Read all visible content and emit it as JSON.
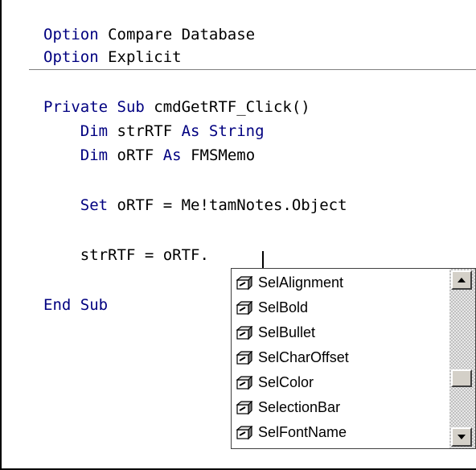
{
  "code": {
    "line1": {
      "kw": "Option",
      "rest": " Compare Database"
    },
    "line2": {
      "kw": "Option",
      "rest": " Explicit"
    },
    "line3": {
      "kw": "Private Sub",
      "rest": " cmdGetRTF_Click()"
    },
    "line4": {
      "indent": "    ",
      "kw1": "Dim",
      "mid": " strRTF ",
      "kw2": "As String"
    },
    "line5": {
      "indent": "    ",
      "kw1": "Dim",
      "mid": " oRTF ",
      "kw2": "As",
      "rest": " FMSMemo"
    },
    "line6": {
      "indent": "    ",
      "kw": "Set",
      "rest": " oRTF = Me!tamNotes.Object"
    },
    "line7": {
      "text": "    strRTF = oRTF."
    },
    "line8": {
      "kw": "End Sub"
    }
  },
  "autocomplete": {
    "items": [
      {
        "label": "SelAlignment",
        "icon": "property-icon"
      },
      {
        "label": "SelBold",
        "icon": "property-icon"
      },
      {
        "label": "SelBullet",
        "icon": "property-icon"
      },
      {
        "label": "SelCharOffset",
        "icon": "property-icon"
      },
      {
        "label": "SelColor",
        "icon": "property-icon"
      },
      {
        "label": "SelectionBar",
        "icon": "property-icon"
      },
      {
        "label": "SelFontName",
        "icon": "property-icon"
      }
    ]
  },
  "colors": {
    "keyword": "#000080",
    "text": "#000000",
    "background": "#ffffff"
  }
}
